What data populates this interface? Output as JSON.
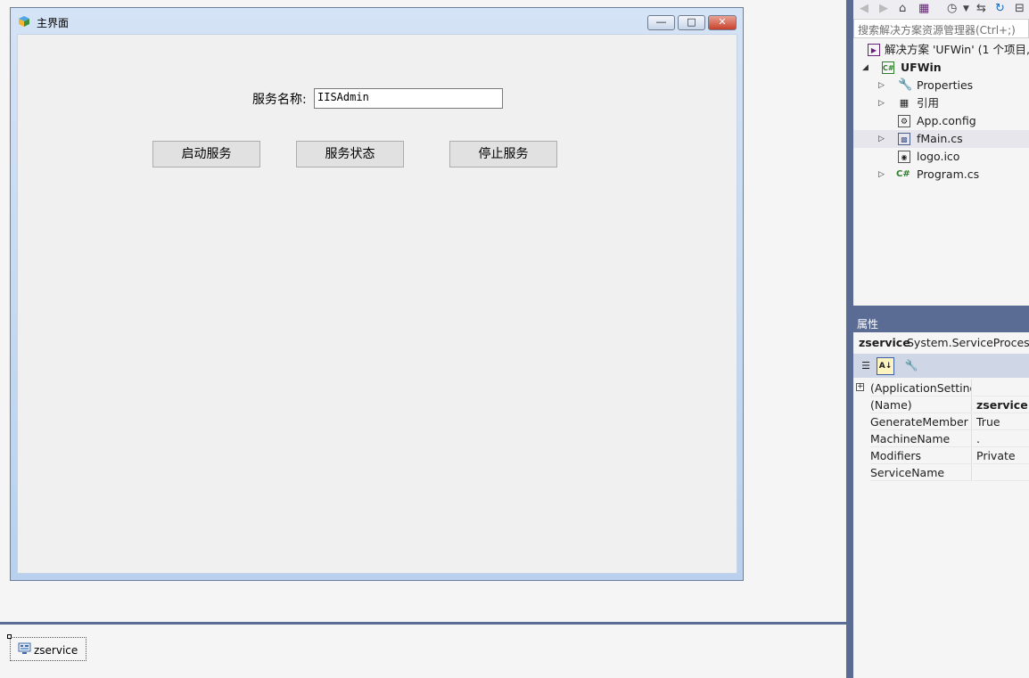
{
  "form": {
    "title": "主界面",
    "service_label": "服务名称:",
    "service_value": "IISAdmin",
    "buttons": {
      "start": "启动服务",
      "status": "服务状态",
      "stop": "停止服务"
    },
    "caption_buttons": {
      "minimize": "▭",
      "maximize": "□",
      "close": "✕"
    }
  },
  "tray": {
    "component": "zservice"
  },
  "solution_explorer": {
    "search_placeholder": "搜索解决方案资源管理器(Ctrl+;)",
    "items": [
      {
        "label": "解决方案 'UFWin' (1 个项目,",
        "icon": "solution-icon"
      },
      {
        "label": "UFWin",
        "icon": "csharp-project-icon"
      },
      {
        "label": "Properties",
        "icon": "wrench-icon"
      },
      {
        "label": "引用",
        "icon": "references-icon"
      },
      {
        "label": "App.config",
        "icon": "config-file-icon"
      },
      {
        "label": "fMain.cs",
        "icon": "form-file-icon"
      },
      {
        "label": "logo.ico",
        "icon": "icon-file-icon"
      },
      {
        "label": "Program.cs",
        "icon": "csharp-file-icon"
      }
    ]
  },
  "properties": {
    "header": "属性",
    "object_name": "zservice",
    "object_type": "System.ServiceProcess.S",
    "rows": [
      {
        "name": "(ApplicationSettings",
        "value": ""
      },
      {
        "name": "(Name)",
        "value": "zservice"
      },
      {
        "name": "GenerateMember",
        "value": "True"
      },
      {
        "name": "MachineName",
        "value": "."
      },
      {
        "name": "Modifiers",
        "value": "Private"
      },
      {
        "name": "ServiceName",
        "value": ""
      }
    ]
  },
  "colors": {
    "accent": "#5b6c94",
    "selection": "#e6e6ec",
    "close_button": "#c8412c"
  }
}
